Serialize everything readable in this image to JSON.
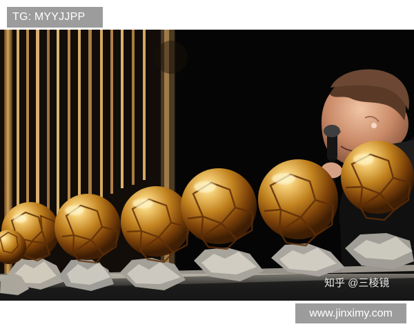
{
  "watermarks": {
    "top_text": "TG: MYYJJPP",
    "bottom_text": "www.jinximy.com",
    "photo_credit": "知乎 @三棱镜"
  },
  "photo": {
    "trophy_count": 7,
    "icons": [
      "gold-ball-trophy",
      "microphone",
      "stage-light"
    ],
    "colors": {
      "background": "#050505",
      "gold": "#d9a441",
      "highlight": "#fff0b8",
      "shadow": "#6c3b08",
      "silver_base": "#9d9b96"
    }
  }
}
